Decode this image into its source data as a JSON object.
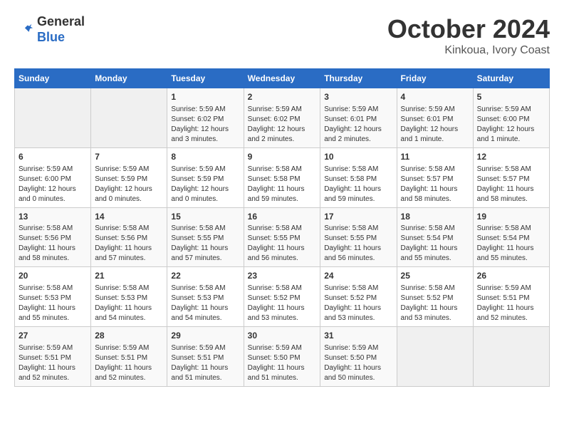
{
  "header": {
    "logo_line1": "General",
    "logo_line2": "Blue",
    "month": "October 2024",
    "location": "Kinkoua, Ivory Coast"
  },
  "days_of_week": [
    "Sunday",
    "Monday",
    "Tuesday",
    "Wednesday",
    "Thursday",
    "Friday",
    "Saturday"
  ],
  "weeks": [
    [
      {
        "day": "",
        "info": ""
      },
      {
        "day": "",
        "info": ""
      },
      {
        "day": "1",
        "info": "Sunrise: 5:59 AM\nSunset: 6:02 PM\nDaylight: 12 hours and 3 minutes."
      },
      {
        "day": "2",
        "info": "Sunrise: 5:59 AM\nSunset: 6:02 PM\nDaylight: 12 hours and 2 minutes."
      },
      {
        "day": "3",
        "info": "Sunrise: 5:59 AM\nSunset: 6:01 PM\nDaylight: 12 hours and 2 minutes."
      },
      {
        "day": "4",
        "info": "Sunrise: 5:59 AM\nSunset: 6:01 PM\nDaylight: 12 hours and 1 minute."
      },
      {
        "day": "5",
        "info": "Sunrise: 5:59 AM\nSunset: 6:00 PM\nDaylight: 12 hours and 1 minute."
      }
    ],
    [
      {
        "day": "6",
        "info": "Sunrise: 5:59 AM\nSunset: 6:00 PM\nDaylight: 12 hours and 0 minutes."
      },
      {
        "day": "7",
        "info": "Sunrise: 5:59 AM\nSunset: 5:59 PM\nDaylight: 12 hours and 0 minutes."
      },
      {
        "day": "8",
        "info": "Sunrise: 5:59 AM\nSunset: 5:59 PM\nDaylight: 12 hours and 0 minutes."
      },
      {
        "day": "9",
        "info": "Sunrise: 5:58 AM\nSunset: 5:58 PM\nDaylight: 11 hours and 59 minutes."
      },
      {
        "day": "10",
        "info": "Sunrise: 5:58 AM\nSunset: 5:58 PM\nDaylight: 11 hours and 59 minutes."
      },
      {
        "day": "11",
        "info": "Sunrise: 5:58 AM\nSunset: 5:57 PM\nDaylight: 11 hours and 58 minutes."
      },
      {
        "day": "12",
        "info": "Sunrise: 5:58 AM\nSunset: 5:57 PM\nDaylight: 11 hours and 58 minutes."
      }
    ],
    [
      {
        "day": "13",
        "info": "Sunrise: 5:58 AM\nSunset: 5:56 PM\nDaylight: 11 hours and 58 minutes."
      },
      {
        "day": "14",
        "info": "Sunrise: 5:58 AM\nSunset: 5:56 PM\nDaylight: 11 hours and 57 minutes."
      },
      {
        "day": "15",
        "info": "Sunrise: 5:58 AM\nSunset: 5:55 PM\nDaylight: 11 hours and 57 minutes."
      },
      {
        "day": "16",
        "info": "Sunrise: 5:58 AM\nSunset: 5:55 PM\nDaylight: 11 hours and 56 minutes."
      },
      {
        "day": "17",
        "info": "Sunrise: 5:58 AM\nSunset: 5:55 PM\nDaylight: 11 hours and 56 minutes."
      },
      {
        "day": "18",
        "info": "Sunrise: 5:58 AM\nSunset: 5:54 PM\nDaylight: 11 hours and 55 minutes."
      },
      {
        "day": "19",
        "info": "Sunrise: 5:58 AM\nSunset: 5:54 PM\nDaylight: 11 hours and 55 minutes."
      }
    ],
    [
      {
        "day": "20",
        "info": "Sunrise: 5:58 AM\nSunset: 5:53 PM\nDaylight: 11 hours and 55 minutes."
      },
      {
        "day": "21",
        "info": "Sunrise: 5:58 AM\nSunset: 5:53 PM\nDaylight: 11 hours and 54 minutes."
      },
      {
        "day": "22",
        "info": "Sunrise: 5:58 AM\nSunset: 5:53 PM\nDaylight: 11 hours and 54 minutes."
      },
      {
        "day": "23",
        "info": "Sunrise: 5:58 AM\nSunset: 5:52 PM\nDaylight: 11 hours and 53 minutes."
      },
      {
        "day": "24",
        "info": "Sunrise: 5:58 AM\nSunset: 5:52 PM\nDaylight: 11 hours and 53 minutes."
      },
      {
        "day": "25",
        "info": "Sunrise: 5:58 AM\nSunset: 5:52 PM\nDaylight: 11 hours and 53 minutes."
      },
      {
        "day": "26",
        "info": "Sunrise: 5:59 AM\nSunset: 5:51 PM\nDaylight: 11 hours and 52 minutes."
      }
    ],
    [
      {
        "day": "27",
        "info": "Sunrise: 5:59 AM\nSunset: 5:51 PM\nDaylight: 11 hours and 52 minutes."
      },
      {
        "day": "28",
        "info": "Sunrise: 5:59 AM\nSunset: 5:51 PM\nDaylight: 11 hours and 52 minutes."
      },
      {
        "day": "29",
        "info": "Sunrise: 5:59 AM\nSunset: 5:51 PM\nDaylight: 11 hours and 51 minutes."
      },
      {
        "day": "30",
        "info": "Sunrise: 5:59 AM\nSunset: 5:50 PM\nDaylight: 11 hours and 51 minutes."
      },
      {
        "day": "31",
        "info": "Sunrise: 5:59 AM\nSunset: 5:50 PM\nDaylight: 11 hours and 50 minutes."
      },
      {
        "day": "",
        "info": ""
      },
      {
        "day": "",
        "info": ""
      }
    ]
  ]
}
